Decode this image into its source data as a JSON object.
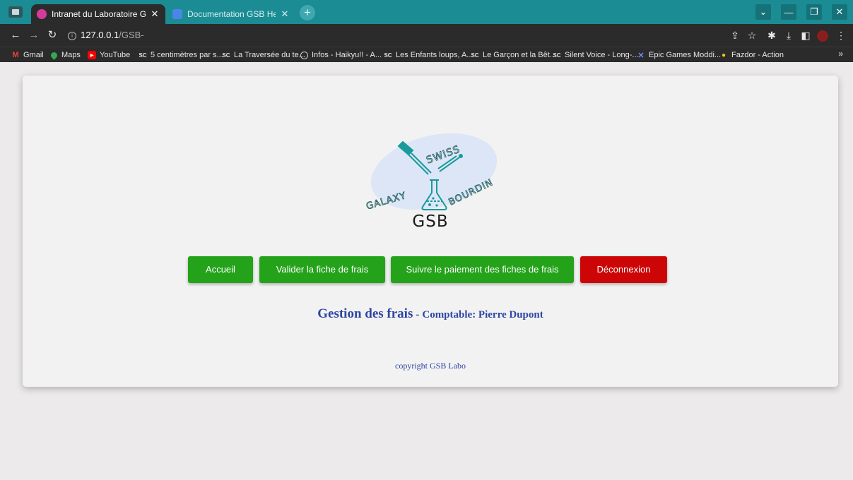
{
  "browser": {
    "tabs": [
      {
        "title": "Intranet du Laboratoire Galaxy-S",
        "active": true
      },
      {
        "title": "Documentation GSB Herque, Pen",
        "active": false
      }
    ],
    "new_tab_symbol": "+",
    "url": {
      "host": "127.0.0.1",
      "path": "/GSB-final_penkov_herque/index.php"
    },
    "bookmarks": [
      {
        "label": "Gmail",
        "icon": "gmail-icon"
      },
      {
        "label": "Maps",
        "icon": "maps-icon"
      },
      {
        "label": "YouTube",
        "icon": "youtube-icon"
      },
      {
        "label": "5 centimètres par s...",
        "icon": "sc-icon"
      },
      {
        "label": "La Traversée du te...",
        "icon": "sc-icon"
      },
      {
        "label": "Infos - Haikyu!! - A...",
        "icon": "globe-icon"
      },
      {
        "label": "Les Enfants loups, A...",
        "icon": "sc-icon"
      },
      {
        "label": "Le Garçon et la Bêt...",
        "icon": "sc-icon"
      },
      {
        "label": "Silent Voice - Long-...",
        "icon": "sc-icon"
      },
      {
        "label": "Epic Games Moddi...",
        "icon": "epic-icon"
      },
      {
        "label": "Fazdor - Action",
        "icon": "bulb-icon"
      }
    ],
    "bookmarks_more": "»"
  },
  "page": {
    "logo": {
      "word1": "SWISS",
      "word2": "GALAXY",
      "word3": "BOURDIN",
      "colors": {
        "ellipse": "#dce6f7",
        "ink": "#1a9a9a"
      }
    },
    "brand": "GSB",
    "menu": [
      {
        "label": "Accueil",
        "color": "#24a31a"
      },
      {
        "label": "Valider la fiche de frais",
        "color": "#24a31a"
      },
      {
        "label": "Suivre le paiement des fiches de frais",
        "color": "#24a31a"
      },
      {
        "label": "Déconnexion",
        "color": "#cc0606"
      }
    ],
    "subtitle": {
      "main": "Gestion des frais",
      "separator": "-",
      "role": "Comptable: Pierre Dupont"
    },
    "footer": "copyright GSB Labo"
  }
}
